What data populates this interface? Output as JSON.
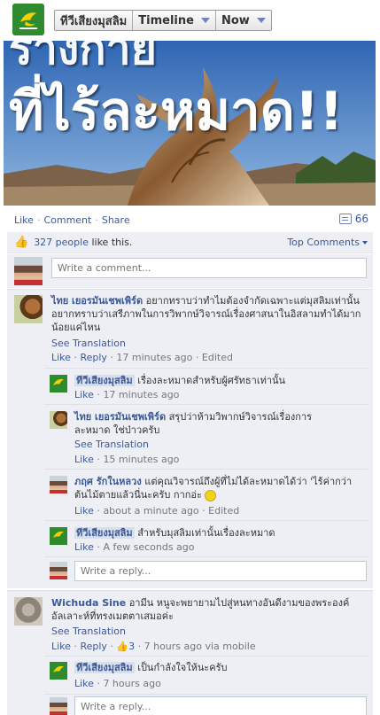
{
  "header": {
    "page_name": "ทีวีเสียงมุสลิม",
    "timeline_label": "Timeline",
    "now_label": "Now",
    "logo_icon": "dove-logo-icon"
  },
  "cover": {
    "line1": "ร่างกาย",
    "line2": "ที่ไร้ละหมาด!!"
  },
  "actions": {
    "like": "Like",
    "comment": "Comment",
    "share": "Share",
    "comment_count": "66"
  },
  "likes": {
    "count_text": "327 people",
    "suffix": " like this.",
    "top_comments": "Top Comments"
  },
  "write_comment_placeholder": "Write a comment...",
  "write_reply_placeholder": "Write a reply...",
  "comments": [
    {
      "author": "ไทย เยอรมันเชพเพิร์ด",
      "text": "อยากทราบว่าทำไมต้องจำกัดเฉพาะแต่มุสลิมเท่านั้น อยากทราบว่าเสรีภาพในการวิพากษ์วิจารณ์เรื่องศาสนาในอิสลามทำได้มากน้อยแค่ไหน",
      "see_translation": "See Translation",
      "like": "Like",
      "reply": "Reply",
      "time": "17 minutes ago",
      "edited": "Edited",
      "replies": [
        {
          "author": "ทีวีเสียงมุสลิม",
          "text": "เรื่องละหมาดสำหรับผู้ศรัทธาเท่านั้น",
          "like": "Like",
          "time": "17 minutes ago"
        },
        {
          "author": "ไทย เยอรมันเชพเพิร์ด",
          "text": "สรุปว่าห้ามวิพากษ์วิจารณ์เรื่องการละหมาด ใช่ป่าวครับ",
          "see_translation": "See Translation",
          "like": "Like",
          "time": "15 minutes ago"
        },
        {
          "author": "ภฤศ รักในหลวง",
          "text": "แต่คุณวิจารณ์ถึงผู้ที่ไม่ได้ละหมาดได้ว่า 'ไร้ค่ากว่าต้นไม้ตายแล้วนี่นะครับ กากอ่ะ",
          "like": "Like",
          "time": "about a minute ago",
          "edited": "Edited"
        },
        {
          "author": "ทีวีเสียงมุสลิม",
          "text": "สำหรับมุสลิมเท่านั้นเรื่องละหมาด",
          "like": "Like",
          "time": "A few seconds ago"
        }
      ]
    },
    {
      "author": "Wichuda Sine",
      "text": "อามีน หนูจะพยายามไปสู่หนทางอันดีงามของพระองค์อัลเลาะห์ที่ทรงเมตตาเสมอค่ะ",
      "see_translation": "See Translation",
      "like": "Like",
      "reply": "Reply",
      "like_count": "3",
      "time": "7 hours ago via mobile",
      "replies": [
        {
          "author": "ทีวีเสียงมุสลิม",
          "text": "เป็นกำลังใจให้นะครับ",
          "like": "Like",
          "time": "7 hours ago"
        }
      ]
    }
  ],
  "colors": {
    "link": "#3b5998",
    "ufi_bg": "#edeff4",
    "page_green": "#2e8b2e"
  }
}
